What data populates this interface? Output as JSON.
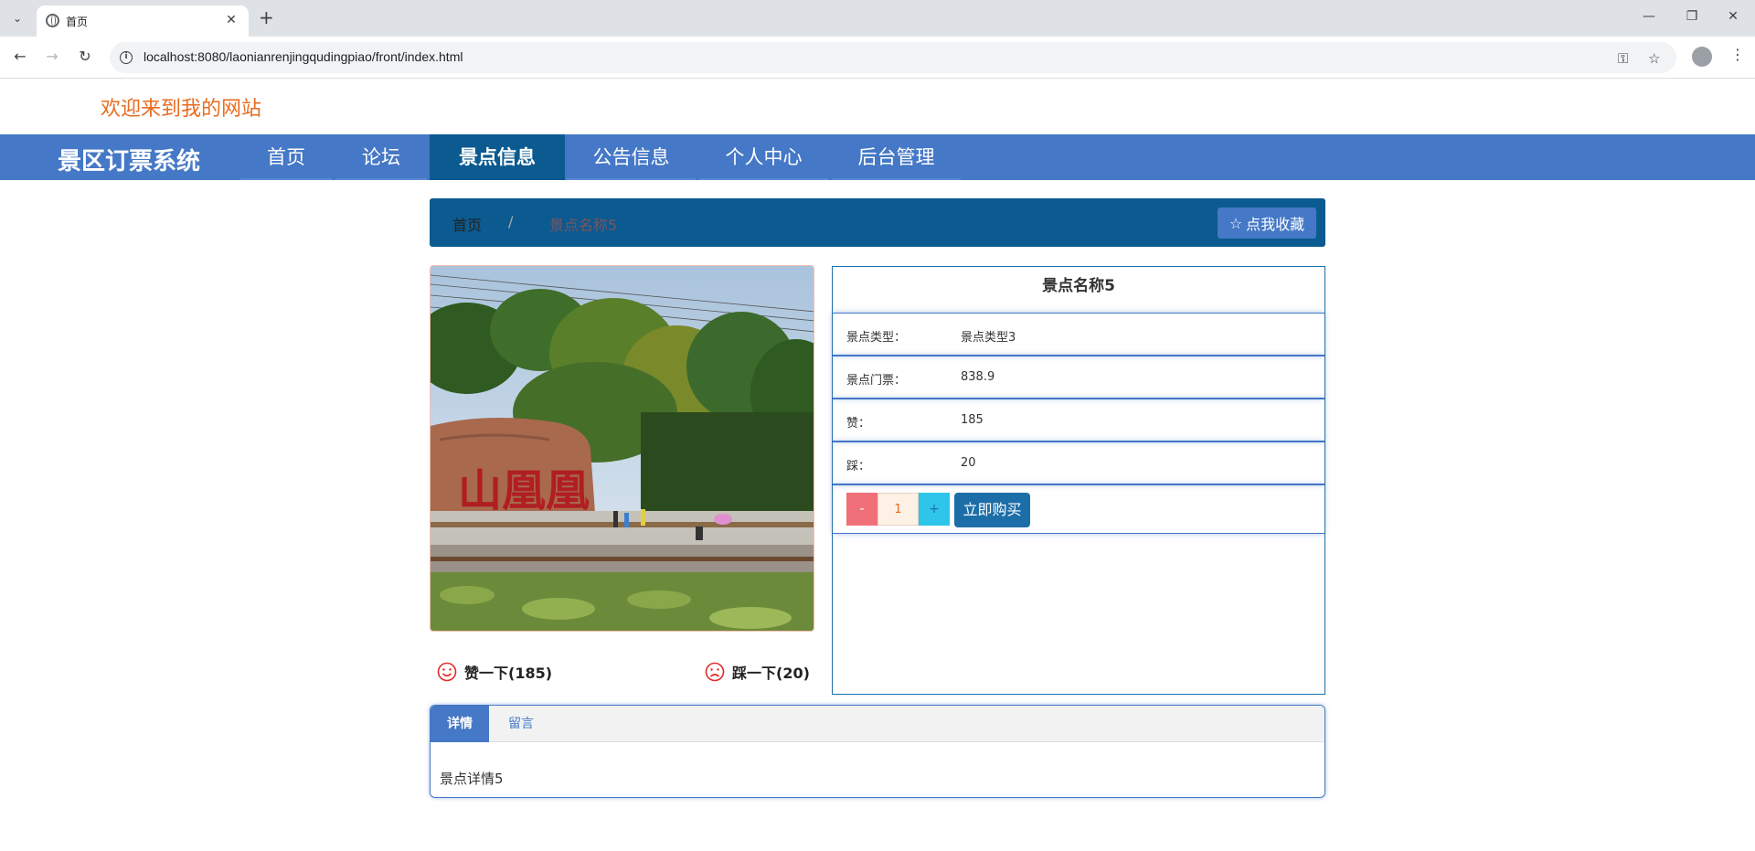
{
  "browser": {
    "tab_title": "首页",
    "url": "localhost:8080/laonianrenjingqudingpiao/front/index.html"
  },
  "site": {
    "welcome": "欢迎来到我的网站",
    "brand": "景区订票系统"
  },
  "nav": {
    "items": [
      {
        "label": "首页"
      },
      {
        "label": "论坛"
      },
      {
        "label": "景点信息",
        "active": true
      },
      {
        "label": "公告信息"
      },
      {
        "label": "个人中心"
      },
      {
        "label": "后台管理"
      }
    ]
  },
  "breadcrumb": {
    "home": "首页",
    "separator": "/",
    "current": "景点名称5"
  },
  "favorite_label": "点我收藏",
  "likes": {
    "like_label": "赞一下(185)",
    "dislike_label": "踩一下(20)"
  },
  "detail": {
    "title": "景点名称5",
    "rows": [
      {
        "key": "景点类型：",
        "value": "景点类型3"
      },
      {
        "key": "景点门票：",
        "value": "838.9"
      },
      {
        "key": "赞：",
        "value": "185"
      },
      {
        "key": "踩：",
        "value": "20"
      }
    ],
    "minus": "-",
    "quantity": "1",
    "plus": "+",
    "buy_label": "立即购买"
  },
  "tabs": {
    "detail_label": "详情",
    "message_label": "留言",
    "content": "景点详情5"
  },
  "colors": {
    "nav_bg": "#4578c6",
    "nav_active": "#0b5a90",
    "welcome": "#e86b1f",
    "accent": "#1c6ea8"
  }
}
